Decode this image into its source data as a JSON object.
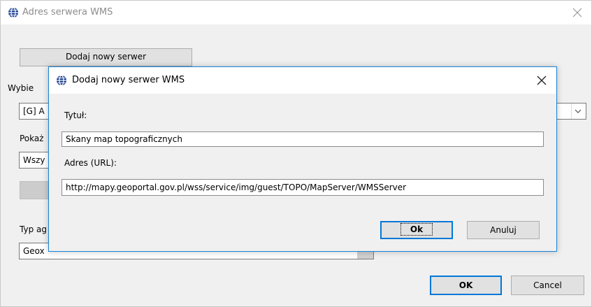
{
  "outer": {
    "title": "Adres serwera WMS",
    "add_server_button": "Dodaj nowy serwer",
    "select_label": "Wybie",
    "select_value": "[G] A",
    "show_label": "Pokaż",
    "show_value": "Wszy",
    "type_label": "Typ ag",
    "type_value": "Geox",
    "ok_button": "OK",
    "cancel_button": "Cancel"
  },
  "dialog": {
    "title": "Dodaj nowy serwer WMS",
    "title_label": "Tytuł:",
    "title_value": "Skany map topograficznych",
    "url_label": "Adres (URL):",
    "url_value": "http://mapy.geoportal.gov.pl/wss/service/img/guest/TOPO/MapServer/WMSServer",
    "ok_button": "Ok",
    "cancel_button": "Anuluj"
  },
  "icons": {
    "app": "globe-icon",
    "close": "close-icon",
    "dropdown": "chevron-down-icon"
  },
  "colors": {
    "focus_blue": "#0078d7",
    "dialog_border": "#1883d7"
  }
}
